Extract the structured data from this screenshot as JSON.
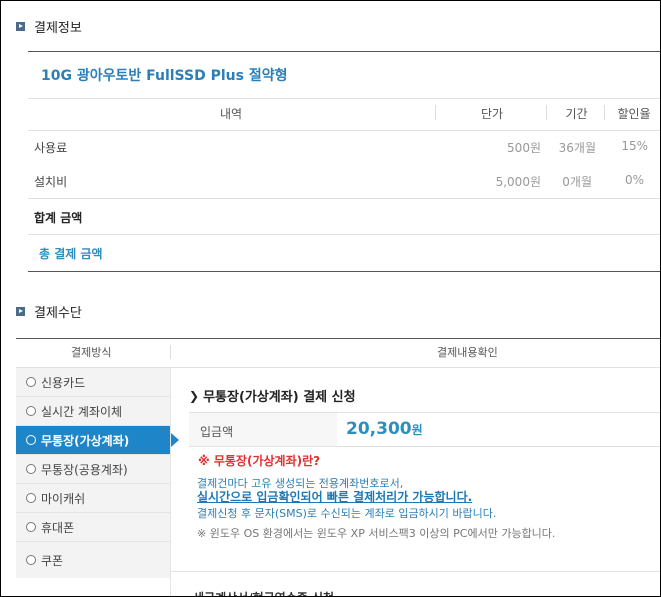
{
  "payment_info": {
    "section_title": "결제정보",
    "plan_name": "10G 광아우토반 FullSSD Plus 절약형",
    "table": {
      "headers": [
        "내역",
        "단가",
        "기간",
        "할인율"
      ],
      "rows": [
        {
          "label": "사용료",
          "price": "500원",
          "period": "36개월",
          "discount": "15%"
        },
        {
          "label": "설치비",
          "price": "5,000원",
          "period": "0개월",
          "discount": "0%"
        }
      ]
    },
    "total_label": "합계 금액",
    "grand_total_label": "총 결제 금액"
  },
  "payment_method": {
    "section_title": "결제수단",
    "col_method": "결제방식",
    "col_confirm": "결제내용확인",
    "options": [
      {
        "label": "신용카드",
        "selected": false
      },
      {
        "label": "실시간 계좌이체",
        "selected": false
      },
      {
        "label": "무통장(가상계좌)",
        "selected": true
      },
      {
        "label": "무통장(공용계좌)",
        "selected": false
      },
      {
        "label": "마이캐쉬",
        "selected": false
      },
      {
        "label": "휴대폰",
        "selected": false
      },
      {
        "label": "쿠폰",
        "selected": false
      }
    ],
    "pane": {
      "title": "무통장(가상계좌) 결제 신청",
      "amount_label": "입금액",
      "amount_value": "20,300",
      "amount_unit": "원",
      "question": "※ 무통장(가상계좌)란?",
      "desc_line1": "결제건마다 고유 생성되는 전용계좌번호로서,",
      "desc_line2": "실시간으로 입금확인되어 빠른 결제처리가 가능합니다.",
      "desc_line3": "결제신청 후 문자(SMS)로 수신되는 계좌로 입금하시기 바랍니다.",
      "note": "※ 윈도우 OS 환경에서는 윈도우 XP 서비스팩3 이상의 PC에서만 가능합니다.",
      "cutoff_heading": "세금계산서/현금영수증 신청"
    }
  },
  "colors": {
    "accent": "#1e86c8",
    "title_blue": "#2b7fb6",
    "alert_red": "#e03030"
  }
}
